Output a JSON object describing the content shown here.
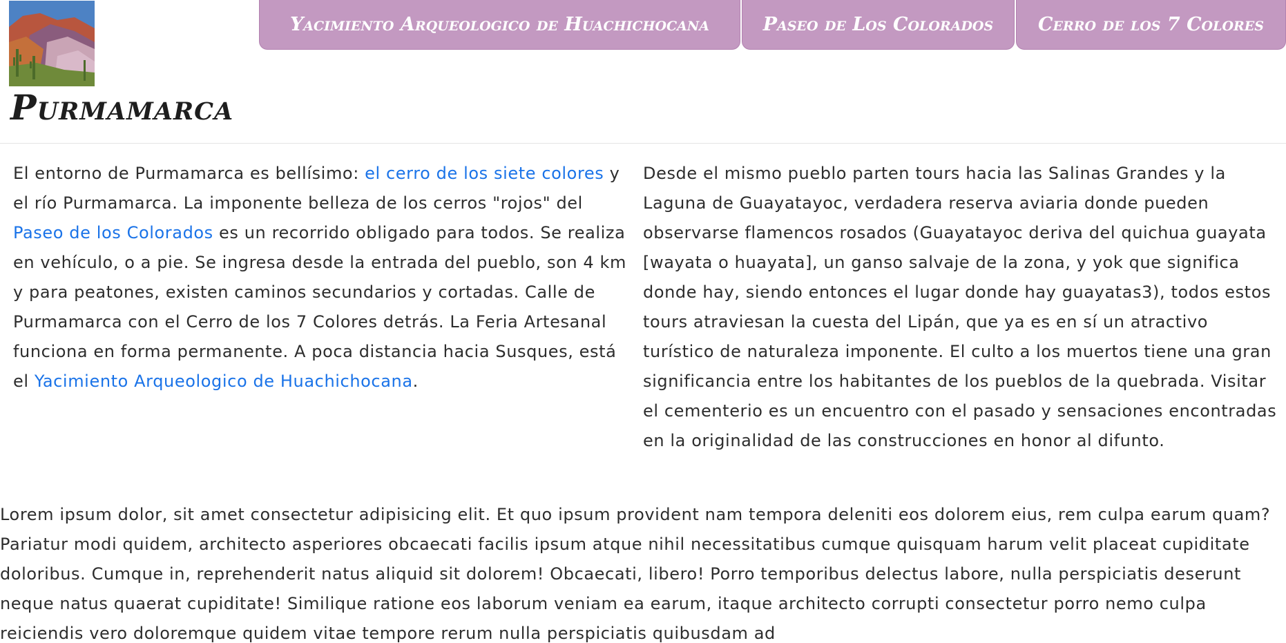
{
  "header": {
    "site_title": "Purmamarca",
    "logo_alt": "Cerro de los 7 Colores",
    "nav": [
      {
        "label": "Yacimiento Arqueologico de Huachichocana"
      },
      {
        "label": "Paseo de Los Colorados"
      },
      {
        "label": "Cerro de los 7 Colores"
      }
    ]
  },
  "content": {
    "left": {
      "t1": "El entorno de Purmamarca es bellísimo: ",
      "link1": "el cerro de los siete colores",
      "t2": " y el río Purmamarca. La imponente belleza de los cerros \"rojos\" del ",
      "link2": "Paseo de los Colorados",
      "t3": " es un recorrido obligado para todos. Se realiza en vehículo, o a pie. Se ingresa desde la entrada del pueblo, son 4 km y para peatones, existen caminos secundarios y cortadas. Calle de Purmamarca con el Cerro de los 7 Colores detrás. La Feria Artesanal funciona en forma permanente. A poca distancia hacia Susques, está el ",
      "link3": "Yacimiento Arqueologico de Huachichocana",
      "t4": "."
    },
    "right": {
      "text": "Desde el mismo pueblo parten tours hacia las Salinas Grandes y la Laguna de Guayatayoc, verdadera reserva aviaria donde pueden observarse flamencos rosados (Guayatayoc deriva del quichua guayata [wayata o huayata], un ganso salvaje de la zona, y yok que significa donde hay, siendo entonces el lugar donde hay guayatas3), todos estos tours atraviesan la cuesta del Lipán, que ya es en sí un atractivo turístico de naturaleza imponente. El culto a los muertos tiene una gran significancia entre los habitantes de los pueblos de la quebrada. Visitar el cementerio es un encuentro con el pasado y sensaciones encontradas en la originalidad de las construcciones en honor al difunto."
    },
    "lorem": "Lorem ipsum dolor, sit amet consectetur adipisicing elit. Et quo ipsum provident nam tempora deleniti eos dolorem eius, rem culpa earum quam? Pariatur modi quidem, architecto asperiores obcaecati facilis ipsum atque nihil necessitatibus cumque quisquam harum velit placeat cupiditate doloribus. Cumque in, reprehenderit natus aliquid sit dolorem! Obcaecati, libero! Porro temporibus delectus labore, nulla perspiciatis deserunt neque natus quaerat cupiditate! Similique ratione eos laborum veniam ea earum, itaque architecto corrupti consectetur porro nemo culpa reiciendis vero doloremque quidem vitae tempore rerum nulla perspiciatis quibusdam ad"
  },
  "colors": {
    "nav_bg": "#c399c1",
    "link": "#1a73e8",
    "text": "#2d2d2d"
  }
}
